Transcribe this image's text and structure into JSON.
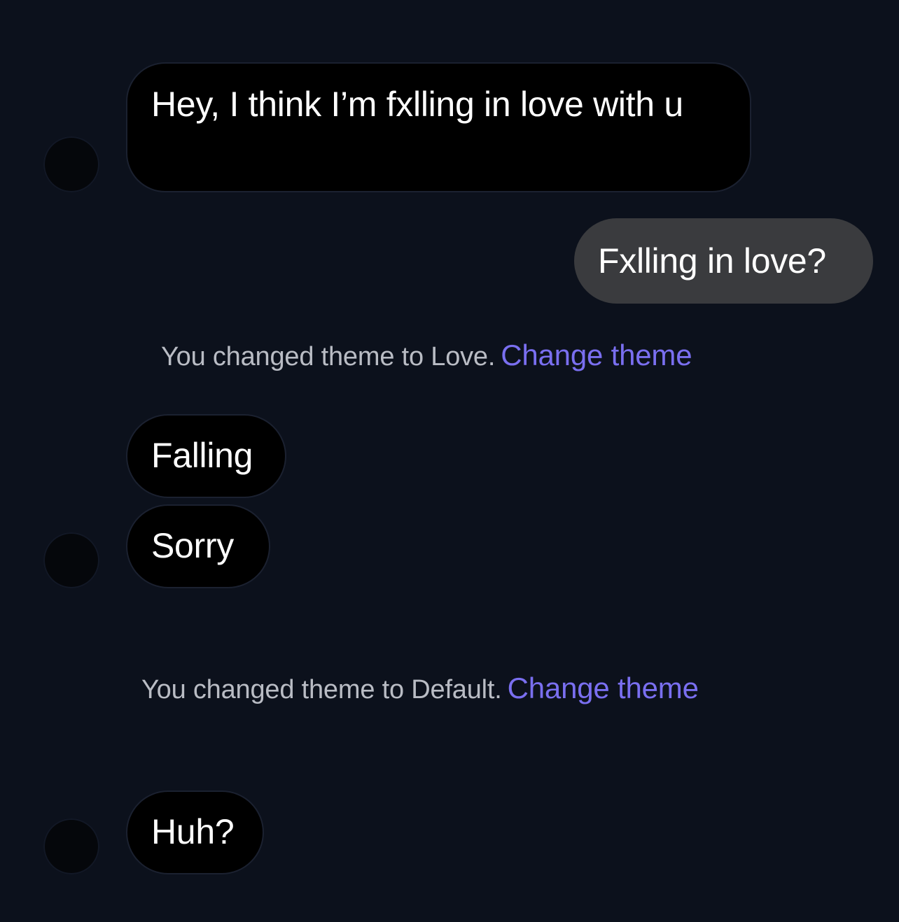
{
  "conversation": {
    "messages": [
      {
        "text": "Hey, I think I’m fxlling in love with u"
      },
      {
        "text": "Fxlling in love?"
      },
      {
        "text": "Falling"
      },
      {
        "text": "Sorry"
      },
      {
        "text": "Huh?"
      }
    ],
    "system_notices": [
      {
        "text": "You changed theme to Love.",
        "link": "Change theme"
      },
      {
        "text": "You changed theme to Default.",
        "link": "Change theme"
      }
    ]
  },
  "colors": {
    "background": "#0c111c",
    "incoming_bubble": "#000000",
    "outgoing_bubble": "#3a3b3e",
    "system_text": "#b9bcc4",
    "link": "#7a6ff0"
  }
}
